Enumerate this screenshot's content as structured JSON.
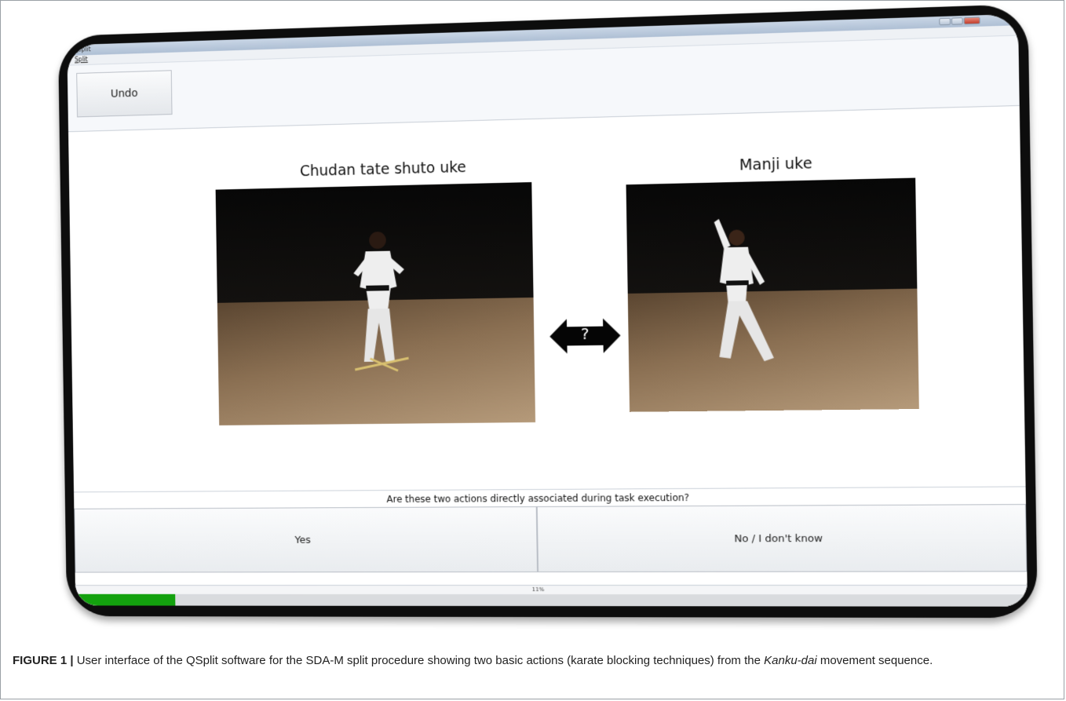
{
  "window": {
    "title": "qsplit",
    "menu_split": "Split"
  },
  "toolbar": {
    "undo_label": "Undo"
  },
  "actions": {
    "left_title": "Chudan tate shuto uke",
    "right_title": "Manji uke",
    "relation_symbol": "?"
  },
  "prompt": {
    "question": "Are these two actions directly associated during task execution?",
    "yes_label": "Yes",
    "no_label": "No / I don't know"
  },
  "progress": {
    "value_text": "11%",
    "fraction": 0.11,
    "fill_color": "#13a10e"
  },
  "caption": {
    "label": "FIGURE 1 |",
    "text_before": " User interface of the QSplit software for the SDA-M split procedure showing two basic actions (karate blocking techniques) from the ",
    "emphasis": "Kanku-dai",
    "text_after": " movement sequence."
  }
}
